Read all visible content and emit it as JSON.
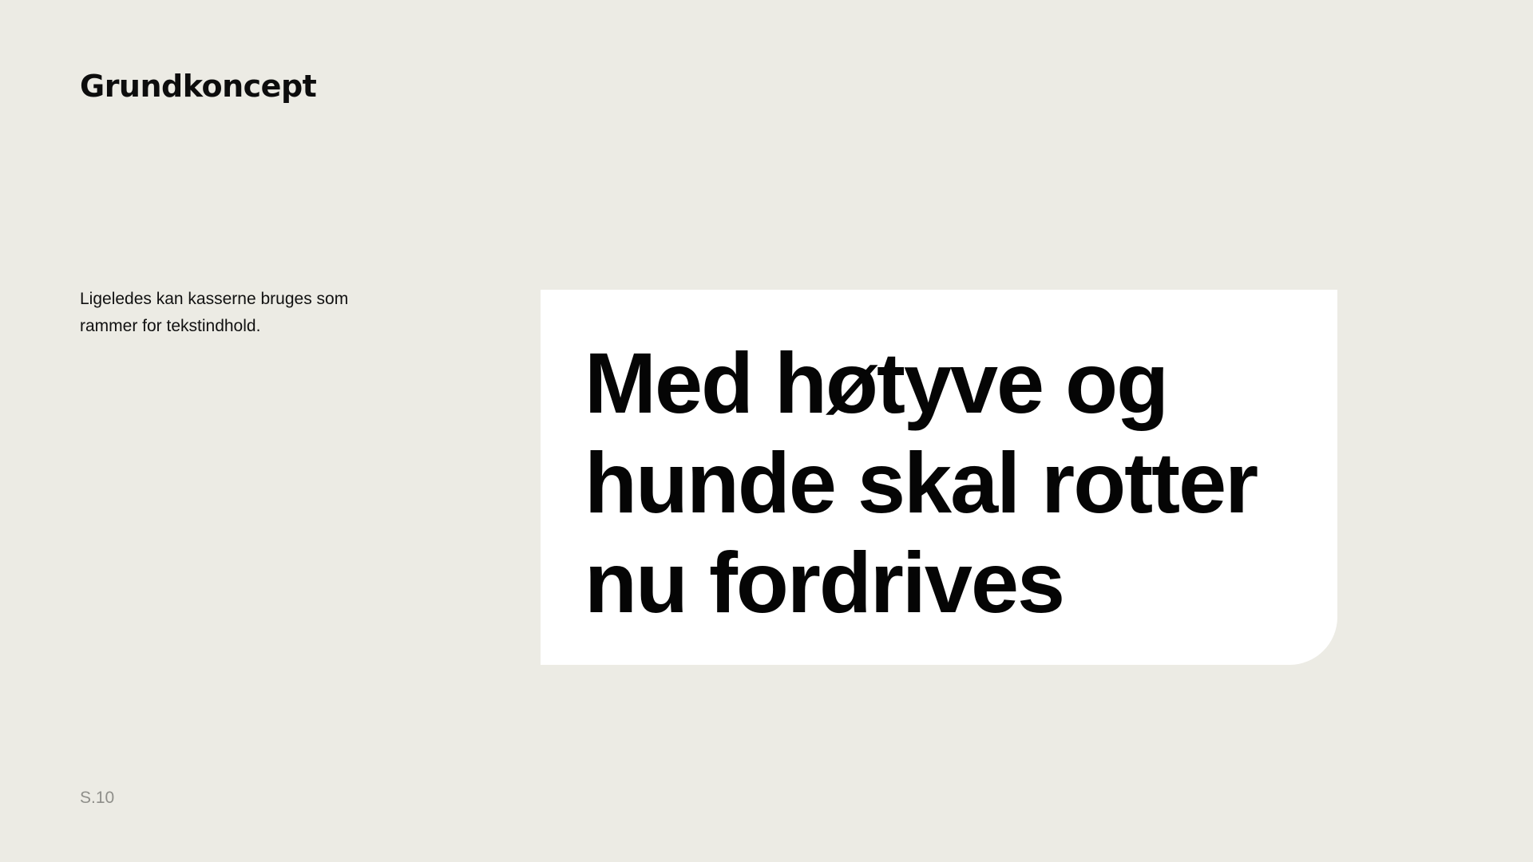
{
  "slide": {
    "title": "Grundkoncept",
    "description": "Ligeledes kan kasserne bruges som rammer for tekstindhold.",
    "headline": "Med høtyve og\nhunde skal rotter\nnu fordrives",
    "page_number": "S.10"
  },
  "colors": {
    "background": "#ECEBE4",
    "box": "#FFFFFF",
    "text": "#0D0D0D",
    "page_number": "#8F8F8A"
  }
}
